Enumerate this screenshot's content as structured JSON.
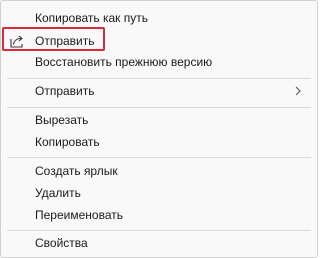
{
  "menu": {
    "items": [
      {
        "label": "Копировать как путь"
      },
      {
        "label": "Отправить",
        "icon": "share-icon"
      },
      {
        "label": "Восстановить прежнюю версию"
      },
      {
        "label": "Отправить",
        "icon": "chevron-right-icon"
      },
      {
        "label": "Вырезать"
      },
      {
        "label": "Копировать"
      },
      {
        "label": "Создать ярлык"
      },
      {
        "label": "Удалить"
      },
      {
        "label": "Переименовать"
      },
      {
        "label": "Свойства"
      }
    ]
  },
  "colors": {
    "highlight": "#d92b3c",
    "background": "#f9f9f9",
    "separator": "#dcdcdc"
  }
}
